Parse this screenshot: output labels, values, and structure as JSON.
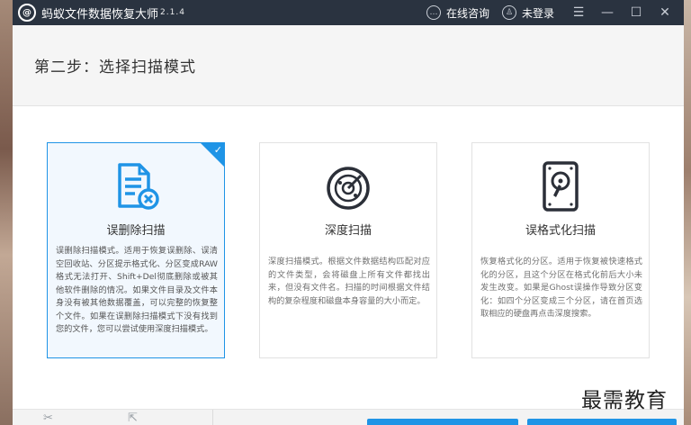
{
  "app": {
    "title": "蚂蚁文件数据恢复大师",
    "version": "2.1.4",
    "online_consult": "在线咨询",
    "login_status": "未登录"
  },
  "header": {
    "step_title": "第二步：选择扫描模式"
  },
  "scan_modes": [
    {
      "title": "误删除扫描",
      "selected": true,
      "icon": "document-delete-icon",
      "description": "误删除扫描模式。适用于恢复误删除、误清空回收站、分区提示格式化、分区变成RAW格式无法打开、Shift+Del彻底删除或被其他软件删除的情况。如果文件目录及文件本身没有被其他数据覆盖，可以完整的恢复整个文件。如果在误删除扫描模式下没有找到您的文件，您可以尝试使用深度扫描模式。"
    },
    {
      "title": "深度扫描",
      "selected": false,
      "icon": "radar-icon",
      "description": "深度扫描模式。根据文件数据结构匹配对应的文件类型，会将磁盘上所有文件都找出来，但没有文件名。扫描的时间根据文件结构的复杂程度和磁盘本身容量的大小而定。"
    },
    {
      "title": "误格式化扫描",
      "selected": false,
      "icon": "disk-icon",
      "description": "恢复格式化的分区。适用于恢复被快速格式化的分区，且这个分区在格式化前后大小未发生改变。如果是Ghost误操作导致分区变化：如四个分区变成三个分区，请在首页选取相应的硬盘再点击深度搜索。"
    }
  ],
  "watermark": "最需教育",
  "colors": {
    "titlebar": "#2a3340",
    "accent": "#1f94e6",
    "icon_dark": "#2b2f38"
  }
}
